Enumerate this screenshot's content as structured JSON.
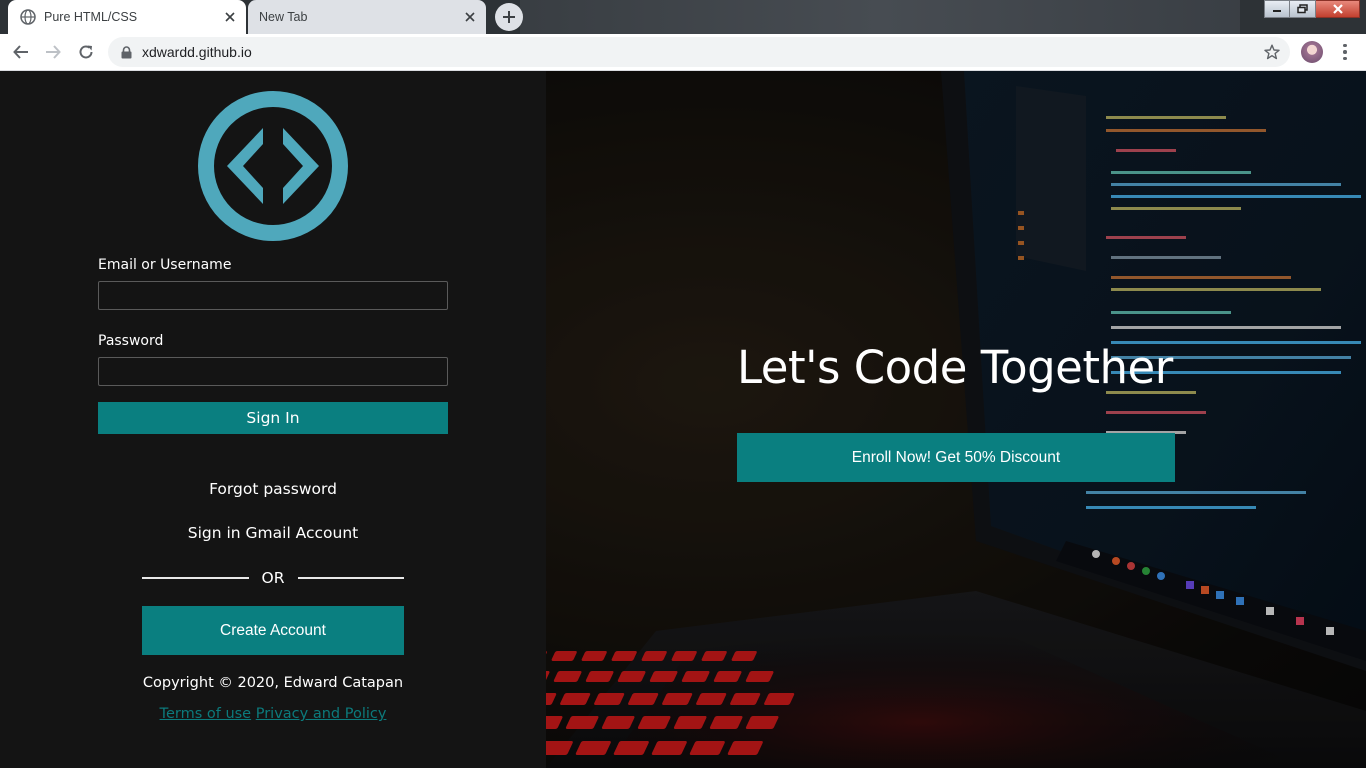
{
  "browser": {
    "tabs": [
      {
        "title": "Pure HTML/CSS",
        "active": true
      },
      {
        "title": "New Tab",
        "active": false
      }
    ],
    "url": "xdwardd.github.io"
  },
  "login": {
    "email_label": "Email or Username",
    "email_value": "",
    "password_label": "Password",
    "password_value": "",
    "signin_label": "Sign In",
    "forgot_label": "Forgot password",
    "gmail_label": "Sign in Gmail Account",
    "or_label": "OR",
    "create_label": "Create Account",
    "copyright": "Copyright © 2020, Edward Catapan",
    "terms_label": "Terms of use",
    "privacy_label": "Privacy and Policy"
  },
  "hero": {
    "title": "Let's Code Together",
    "enroll_label": "Enroll Now! Get 50% Discount"
  },
  "colors": {
    "accent": "#0a7f80",
    "logo": "#4fa8bc",
    "panel": "#141414",
    "link": "#0c7a7c"
  },
  "icons": [
    "globe-icon",
    "close-icon",
    "plus-icon",
    "back-arrow-icon",
    "forward-arrow-icon",
    "reload-icon",
    "lock-icon",
    "star-icon",
    "avatar",
    "menu-icon",
    "code-logo-icon"
  ]
}
